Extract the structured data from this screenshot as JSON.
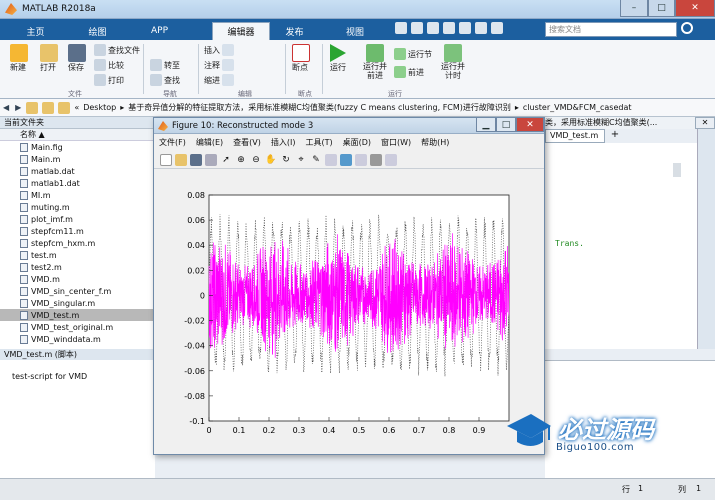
{
  "window": {
    "title": "MATLAB R2018a",
    "min": "–",
    "max": "□",
    "close": "✕"
  },
  "tabs": [
    "主页",
    "绘图",
    "APP",
    "编辑器",
    "发布",
    "视图"
  ],
  "search": {
    "placeholder": "搜索文档"
  },
  "ribbon": {
    "new": "新建",
    "open": "打开",
    "save": "保存",
    "find_files": "查找文件",
    "compare": "比较",
    "print": "打印",
    "insert": "插入",
    "comment": "注释",
    "indent": "缩进",
    "goto": "转至",
    "find": "查找",
    "breakpoint": "断点",
    "run": "运行",
    "run_advance": "运行并\n前进",
    "run_section": "运行节",
    "advance": "前进",
    "run_time": "运行并\n计时",
    "groups": {
      "file": "文件",
      "nav": "导航",
      "edit": "编辑",
      "bp": "断点",
      "run": "运行"
    }
  },
  "address": {
    "path": [
      "Desktop",
      "基于奇异值分解的特征提取方法，采用标准模糊C均值聚类(fuzzy C means clustering, FCM)进行故障识别",
      "cluster_VMD&FCM_casedat"
    ]
  },
  "current_folder": {
    "header": "当前文件夹",
    "col_name": "名称 ▲",
    "files": [
      "Main.fig",
      "Main.m",
      "matlab.dat",
      "matlab1.dat",
      "MI.m",
      "muting.m",
      "plot_imf.m",
      "stepfcm11.m",
      "stepfcm_hxm.m",
      "test.m",
      "test2.m",
      "VMD.m",
      "VMD_sin_center_f.m",
      "VMD_singular.m",
      "VMD_test.m",
      "VMD_test_original.m",
      "VMD_winddata.m"
    ],
    "selected": "VMD_test.m"
  },
  "details": {
    "header": "VMD_test.m (脚本)",
    "desc": "test-script for VMD"
  },
  "figure": {
    "title": "Figure 10: Reconstructed mode 3",
    "min": "▁",
    "max": "□",
    "close": "✕",
    "menus": [
      "文件(F)",
      "编辑(E)",
      "查看(V)",
      "插入(I)",
      "工具(T)",
      "桌面(D)",
      "窗口(W)",
      "帮助(H)"
    ]
  },
  "editor": {
    "tab": "VMD_test.m",
    "add_tab": "+",
    "path_snippet": "类，采用标准模糊C均值聚类(...",
    "code_snippet": "Trans."
  },
  "status": {
    "row_label": "行",
    "row": "1",
    "col_label": "列",
    "col": "1"
  },
  "watermark": {
    "text": "必过源码",
    "url": "Biguo100.com"
  },
  "chart_data": {
    "type": "line",
    "title": "",
    "xlabel": "",
    "ylabel": "",
    "xlim": [
      0,
      1
    ],
    "ylim": [
      -0.1,
      0.08
    ],
    "xticks": [
      "0",
      "0.1",
      "0.2",
      "0.3",
      "0.4",
      "0.5",
      "0.6",
      "0.7",
      "0.8",
      "0.9"
    ],
    "yticks": [
      "0.08",
      "0.06",
      "0.04",
      "0.02",
      "0",
      "-0.02",
      "-0.04",
      "-0.06",
      "-0.08",
      "-0.1"
    ],
    "series": [
      {
        "color": "#ff00ff",
        "style": "solid",
        "amplitude": 0.05
      },
      {
        "color": "#333333",
        "style": "dotted",
        "amplitude": 0.065
      }
    ],
    "grid": false
  }
}
